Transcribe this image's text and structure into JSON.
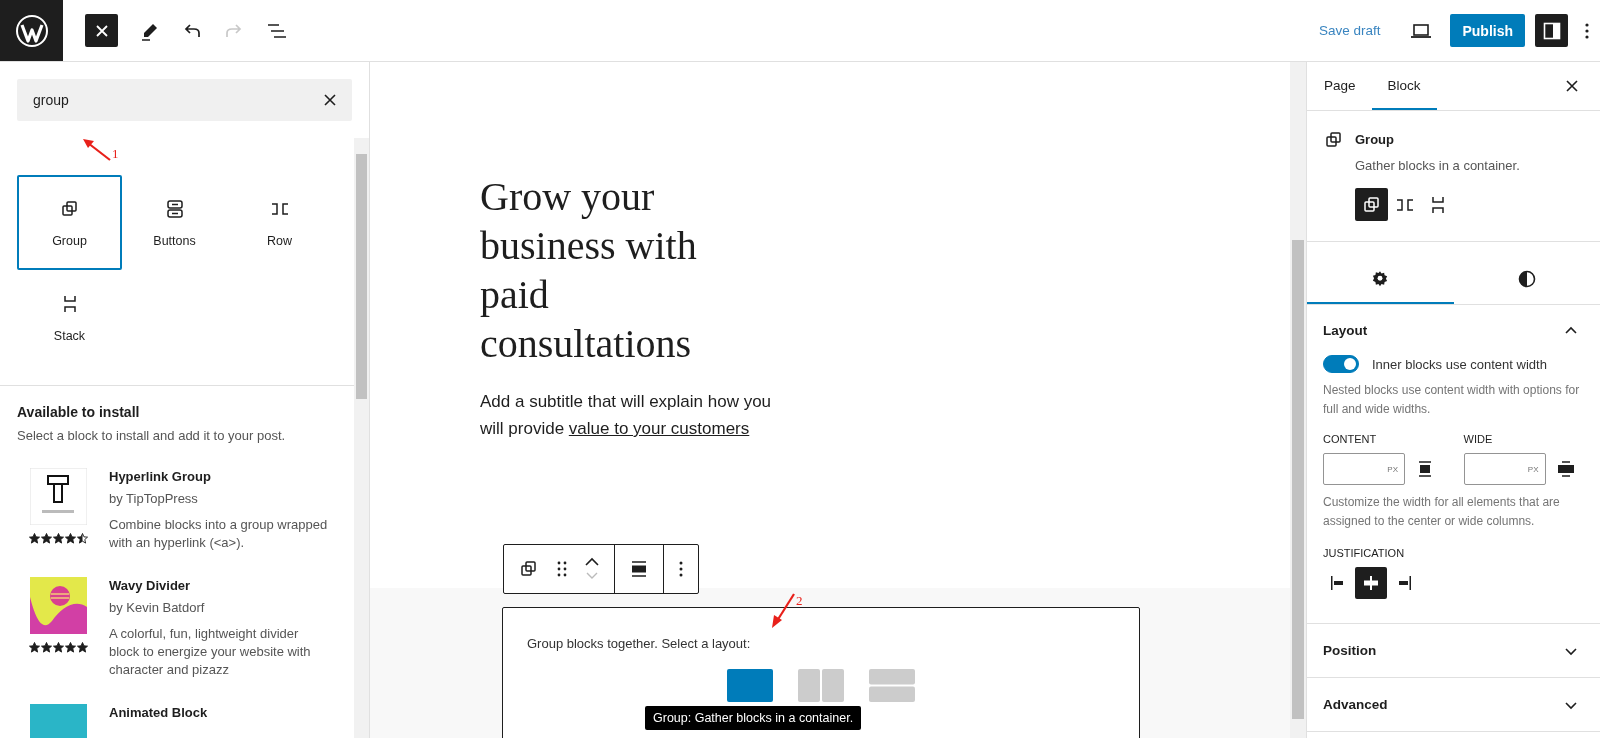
{
  "top_bar": {
    "inserter_open": true,
    "save_draft": "Save draft",
    "publish": "Publish",
    "settings_open": true
  },
  "inserter": {
    "search": {
      "value": "group"
    },
    "blocks": [
      {
        "label": "Group",
        "kind": "group",
        "selected": true
      },
      {
        "label": "Buttons",
        "kind": "buttons",
        "selected": false
      },
      {
        "label": "Row",
        "kind": "row",
        "selected": false
      },
      {
        "label": "Stack",
        "kind": "stack",
        "selected": false
      }
    ],
    "install": {
      "heading": "Available to install",
      "description": "Select a block to install and add it to your post.",
      "plugins": [
        {
          "name": "Hyperlink Group",
          "author": "by TipTopPress",
          "description": "Combine blocks into a group wrapped with an hyperlink (<a>).",
          "stars": 4.5,
          "kind": "mark"
        },
        {
          "name": "Wavy Divider",
          "author": "by Kevin Batdorf",
          "description": "A colorful, fun, lightweight divider block to energize your website with character and pizazz",
          "stars": 5,
          "kind": "wave"
        },
        {
          "name": "Animated Block",
          "kind": "teal"
        }
      ]
    }
  },
  "canvas": {
    "heading": "Grow your business with paid consultations",
    "subtitle": "Add a subtitle that will explain how you will provide",
    "subtitle_link": "value to your customers",
    "placeholder": {
      "text": "Group blocks together. Select a layout:",
      "layouts": [
        {
          "kind": "group",
          "selected": true
        },
        {
          "kind": "row",
          "selected": false
        },
        {
          "kind": "stack",
          "selected": false
        }
      ],
      "tooltip": "Group: Gather blocks in a container."
    }
  },
  "annotations": [
    {
      "label": "1"
    },
    {
      "label": "2"
    }
  ],
  "sidebar": {
    "tabs": [
      {
        "label": "Page",
        "selected": false
      },
      {
        "label": "Block",
        "selected": true
      }
    ],
    "block": {
      "name": "Group",
      "description": "Gather blocks in a container.",
      "variations": [
        {
          "kind": "group",
          "selected": true
        },
        {
          "kind": "row",
          "selected": false
        },
        {
          "kind": "stack",
          "selected": false
        }
      ]
    },
    "inspector_tabs": [
      {
        "kind": "settings",
        "selected": true
      },
      {
        "kind": "styles",
        "selected": false
      }
    ],
    "layout": {
      "title": "Layout",
      "expanded": true,
      "toggle": {
        "label": "Inner blocks use content width",
        "on": true
      },
      "toggle_help": "Nested blocks use content width with options for full and wide widths.",
      "fields": [
        {
          "label": "CONTENT",
          "unit": "PX",
          "kind": "content"
        },
        {
          "label": "WIDE",
          "unit": "PX",
          "kind": "wide"
        }
      ],
      "fields_help": "Customize the width for all elements that are assigned to the center or wide columns.",
      "justification": {
        "label": "JUSTIFICATION",
        "options": [
          {
            "kind": "left",
            "selected": false
          },
          {
            "kind": "center",
            "selected": true
          },
          {
            "kind": "right",
            "selected": false
          }
        ]
      }
    },
    "panels": [
      {
        "title": "Position",
        "expanded": false
      },
      {
        "title": "Advanced",
        "expanded": false
      }
    ]
  }
}
